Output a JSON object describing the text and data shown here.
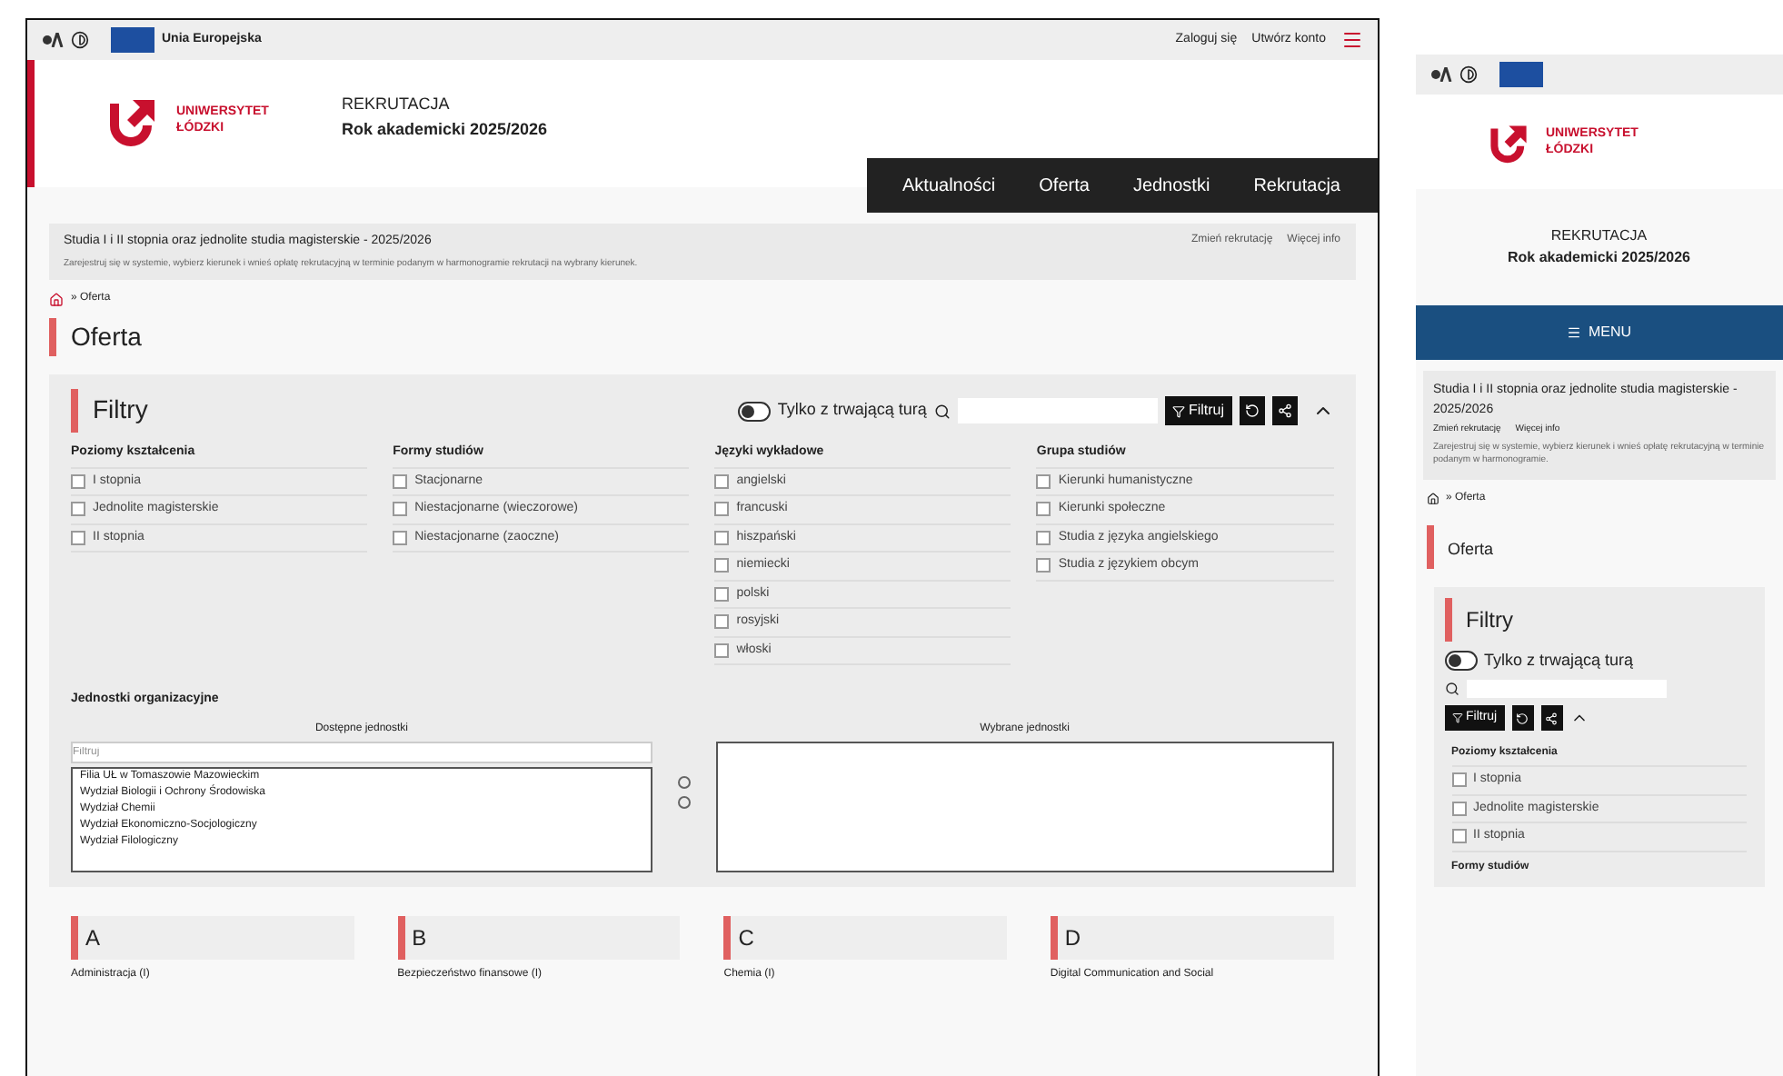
{
  "desktop": {
    "topbar": {
      "eu_label": "Unia Europejska",
      "links": [
        "Zaloguj się",
        "Utwórz konto"
      ]
    },
    "header": {
      "logo_text": [
        "UNIWERSYTET",
        "ŁÓDZKI"
      ],
      "title": "REKRUTACJA",
      "subtitle": "Rok akademicki 2025/2026"
    },
    "nav": [
      {
        "label": "Aktualności",
        "selected": false
      },
      {
        "label": "Oferta",
        "selected": false
      },
      {
        "label": "Jednostki",
        "selected": false
      },
      {
        "label": "Rekrutacja",
        "selected": false
      }
    ],
    "notice": {
      "title": "Studia I i II stopnia oraz jednolite studia magisterskie - 2025/2026",
      "links": [
        "Zmień rekrutację",
        "Więcej info"
      ],
      "text": "Zarejestruj się w systemie, wybierz kierunek i wnieś opłatę rekrutacyjną w terminie podanym w harmonogramie rekrutacji na wybrany kierunek."
    },
    "breadcrumb": "» Oferta",
    "heading": "Oferta",
    "filters": {
      "title": "Filtry",
      "toggle": {
        "label": "Tylko z trwającą turą",
        "on": false
      },
      "apply": "Filtruj",
      "groups": [
        {
          "title": "Poziomy kształcenia",
          "options": [
            {
              "label": "I stopnia",
              "checked": false
            },
            {
              "label": "Jednolite magisterskie",
              "checked": false
            },
            {
              "label": "II stopnia",
              "checked": false
            }
          ]
        },
        {
          "title": "Formy studiów",
          "options": [
            {
              "label": "Stacjonarne",
              "checked": false
            },
            {
              "label": "Niestacjonarne (wieczorowe)",
              "checked": false
            },
            {
              "label": "Niestacjonarne (zaoczne)",
              "checked": false
            }
          ]
        },
        {
          "title": "Języki wykładowe",
          "options": [
            {
              "label": "angielski",
              "checked": false
            },
            {
              "label": "francuski",
              "checked": false
            },
            {
              "label": "hiszpański",
              "checked": false
            },
            {
              "label": "niemiecki",
              "checked": false
            },
            {
              "label": "polski",
              "checked": false
            },
            {
              "label": "rosyjski",
              "checked": false
            },
            {
              "label": "włoski",
              "checked": false
            }
          ]
        },
        {
          "title": "Grupa studiów",
          "options": [
            {
              "label": "Kierunki humanistyczne",
              "checked": false
            },
            {
              "label": "Kierunki społeczne",
              "checked": false
            },
            {
              "label": "Studia z języka angielskiego",
              "checked": false
            },
            {
              "label": "Studia z językiem obcym",
              "checked": false
            }
          ]
        }
      ],
      "units": {
        "title": "Jednostki organizacyjne",
        "available_label": "Dostępne jednostki",
        "selected_label": "Wybrane jednostki",
        "filter_placeholder": "Filtruj",
        "available": [
          "Filia UŁ w Tomaszowie Mazowieckim",
          "Wydział Biologii i Ochrony Środowiska",
          "Wydział Chemii",
          "Wydział Ekonomiczno-Socjologiczny",
          "Wydział Filologiczny"
        ]
      }
    },
    "sections": [
      {
        "letter": "A",
        "first": "Administracja (I)"
      },
      {
        "letter": "B",
        "first": "Bezpieczeństwo finansowe (I)"
      },
      {
        "letter": "C",
        "first": "Chemia (I)"
      },
      {
        "letter": "D",
        "first": "Digital Communication and Social"
      }
    ]
  },
  "mobile": {
    "logo_text": [
      "UNIWERSYTET",
      "ŁÓDZKI"
    ],
    "title": "REKRUTACJA",
    "subtitle": "Rok akademicki 2025/2026",
    "menu": "MENU",
    "notice": {
      "title": "Studia I i II stopnia oraz jednolite studia magisterskie - 2025/2026",
      "links": [
        "Zmień rekrutację",
        "Więcej info"
      ],
      "text": "Zarejestruj się w systemie, wybierz kierunek i wnieś opłatę rekrutacyjną w terminie podanym w harmonogramie."
    },
    "breadcrumb": "» Oferta",
    "heading": "Oferta",
    "filters_title": "Filtry",
    "toggle": {
      "label": "Tylko z trwającą turą",
      "on": false
    },
    "apply": "Filtruj",
    "group": {
      "title": "Poziomy kształcenia",
      "options": [
        {
          "label": "I stopnia",
          "checked": false
        },
        {
          "label": "Jednolite magisterskie",
          "checked": false
        },
        {
          "label": "II stopnia",
          "checked": false
        }
      ]
    },
    "next_group": "Formy studiów"
  }
}
